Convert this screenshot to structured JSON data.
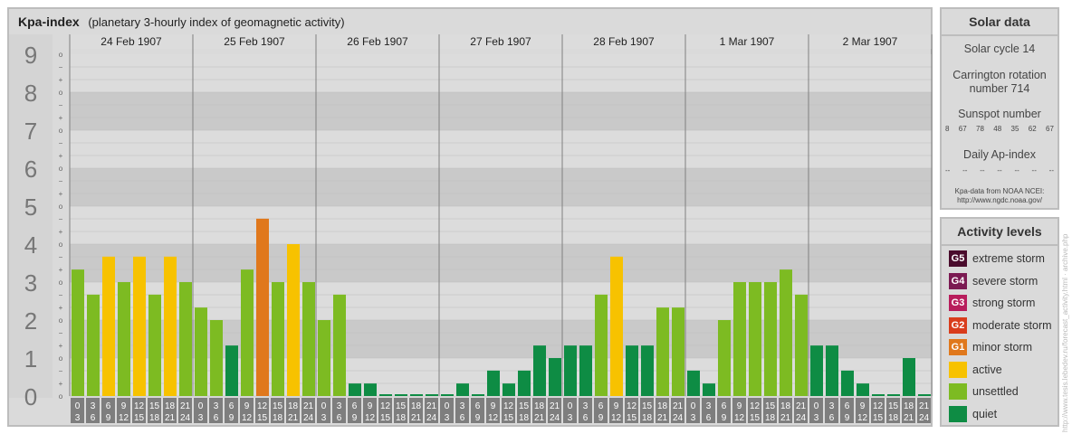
{
  "main": {
    "title": "Kpa-index",
    "subtitle": "(planetary 3-hourly index of geomagnetic activity)"
  },
  "chart_data": {
    "type": "bar",
    "title": "Kpa-index",
    "subtitle": "(planetary 3-hourly index of geomagnetic activity)",
    "ylim": [
      0,
      9
    ],
    "y_ticks": [
      "0",
      "1",
      "2",
      "3",
      "4",
      "5",
      "6",
      "7",
      "8",
      "9"
    ],
    "y_subticks": [
      "o",
      "+",
      "−"
    ],
    "dates": [
      "24 Feb 1907",
      "25 Feb 1907",
      "26 Feb 1907",
      "27 Feb 1907",
      "28 Feb 1907",
      "1 Mar 1907",
      "2 Mar 1907"
    ],
    "interval_start_labels": [
      "0",
      "3",
      "6",
      "9",
      "12",
      "15",
      "18",
      "21"
    ],
    "interval_end_labels": [
      "3",
      "6",
      "9",
      "12",
      "15",
      "18",
      "21",
      "24"
    ],
    "values": [
      3.33,
      2.67,
      3.67,
      3.0,
      3.67,
      2.67,
      3.67,
      3.0,
      2.33,
      2.0,
      1.33,
      3.33,
      4.67,
      3.0,
      4.0,
      3.0,
      2.0,
      2.67,
      0.33,
      0.33,
      0.0,
      0.0,
      0.0,
      0.0,
      0.0,
      0.33,
      0.0,
      0.67,
      0.33,
      0.67,
      1.33,
      1.0,
      1.33,
      1.33,
      2.67,
      3.67,
      1.33,
      1.33,
      2.33,
      2.33,
      0.67,
      0.33,
      2.0,
      3.0,
      3.0,
      3.0,
      3.33,
      2.67,
      1.33,
      1.33,
      0.67,
      0.33,
      0.0,
      0.0,
      1.0,
      0.0
    ],
    "colors": {
      "quiet": "#0e8c44",
      "unsettled": "#7dbb22",
      "active": "#f7c200",
      "G1": "#e0781c",
      "G2": "#d93c1c",
      "G3": "#b81d5c",
      "G4": "#7b1a52",
      "G5": "#4a0c2c"
    },
    "grid": true,
    "legend": "right"
  },
  "solar": {
    "title": "Solar data",
    "cycle": "Solar cycle 14",
    "carrington_1": "Carrington rotation",
    "carrington_2": "number 714",
    "sunspot_title": "Sunspot number",
    "sunspots": [
      "8",
      "67",
      "78",
      "48",
      "35",
      "62",
      "67"
    ],
    "ap_title": "Daily Ap-index",
    "ap_values": [
      "--",
      "--",
      "--",
      "--",
      "--",
      "--",
      "--"
    ],
    "source_1": "Kpa-data from NOAA NCEI:",
    "source_2": "http://www.ngdc.noaa.gov/"
  },
  "levels": {
    "title": "Activity levels",
    "items": [
      {
        "badge": "G5",
        "label": "extreme storm",
        "color": "#4a0c2c"
      },
      {
        "badge": "G4",
        "label": "severe storm",
        "color": "#7b1a52"
      },
      {
        "badge": "G3",
        "label": "strong storm",
        "color": "#b81d5c"
      },
      {
        "badge": "G2",
        "label": "moderate storm",
        "color": "#d93c1c"
      },
      {
        "badge": "G1",
        "label": "minor storm",
        "color": "#e0781c"
      },
      {
        "badge": "",
        "label": "active",
        "color": "#f7c200"
      },
      {
        "badge": "",
        "label": "unsettled",
        "color": "#7dbb22"
      },
      {
        "badge": "",
        "label": "quiet",
        "color": "#0e8c44"
      }
    ]
  },
  "credit": "http://www.tesis.lebedev.ru/forecast_activity.html · archive.php"
}
